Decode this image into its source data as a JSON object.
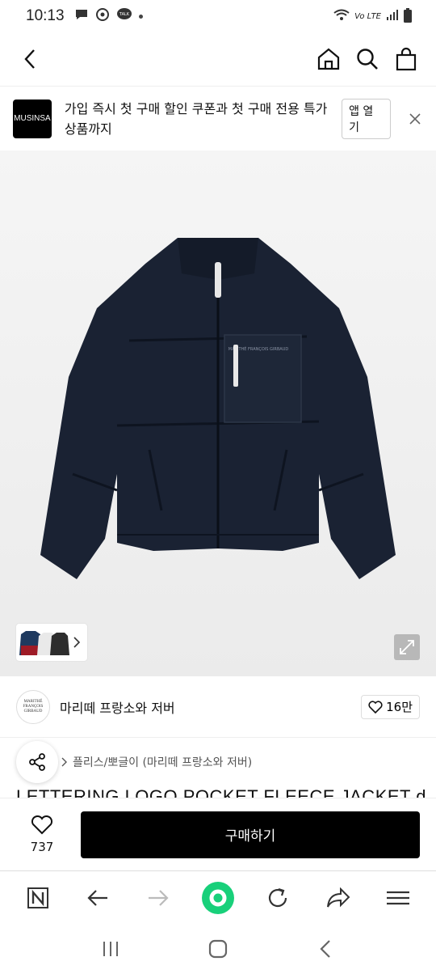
{
  "status_bar": {
    "time": "10:13",
    "notifications": [
      "chat-icon",
      "recycle-icon",
      "talk-icon"
    ],
    "talk_label": "TALK",
    "network_label": "Vo LTE"
  },
  "header": {
    "back_icon": "chevron-left-icon",
    "home_icon": "home-icon",
    "search_icon": "search-icon",
    "cart_icon": "bag-icon"
  },
  "banner": {
    "logo_text": "MUSINSA",
    "message": "가입 즉시 첫 구매 할인 쿠폰과 첫 구매 전용 특가 상품까지",
    "open_app_label": "앱 열기"
  },
  "brand": {
    "logo_text": "MARITHÉ FRANÇOIS GIRBAUD",
    "name": "마리떼 프랑소와 저버",
    "like_count": "16만"
  },
  "category": {
    "path": "플리스/뽀글이 (마리떼 프랑소와 저버)"
  },
  "product": {
    "title": "LETTERING LOGO POCKET FLEECE JACKET d",
    "pocket_text": "MARITHÉ FRANÇOIS GIRBAUD"
  },
  "buy_bar": {
    "like_count": "737",
    "buy_label": "구매하기"
  },
  "colors": {
    "jacket": "#1a2233",
    "buy_button": "#000000",
    "browser_center": "#18d07a"
  }
}
